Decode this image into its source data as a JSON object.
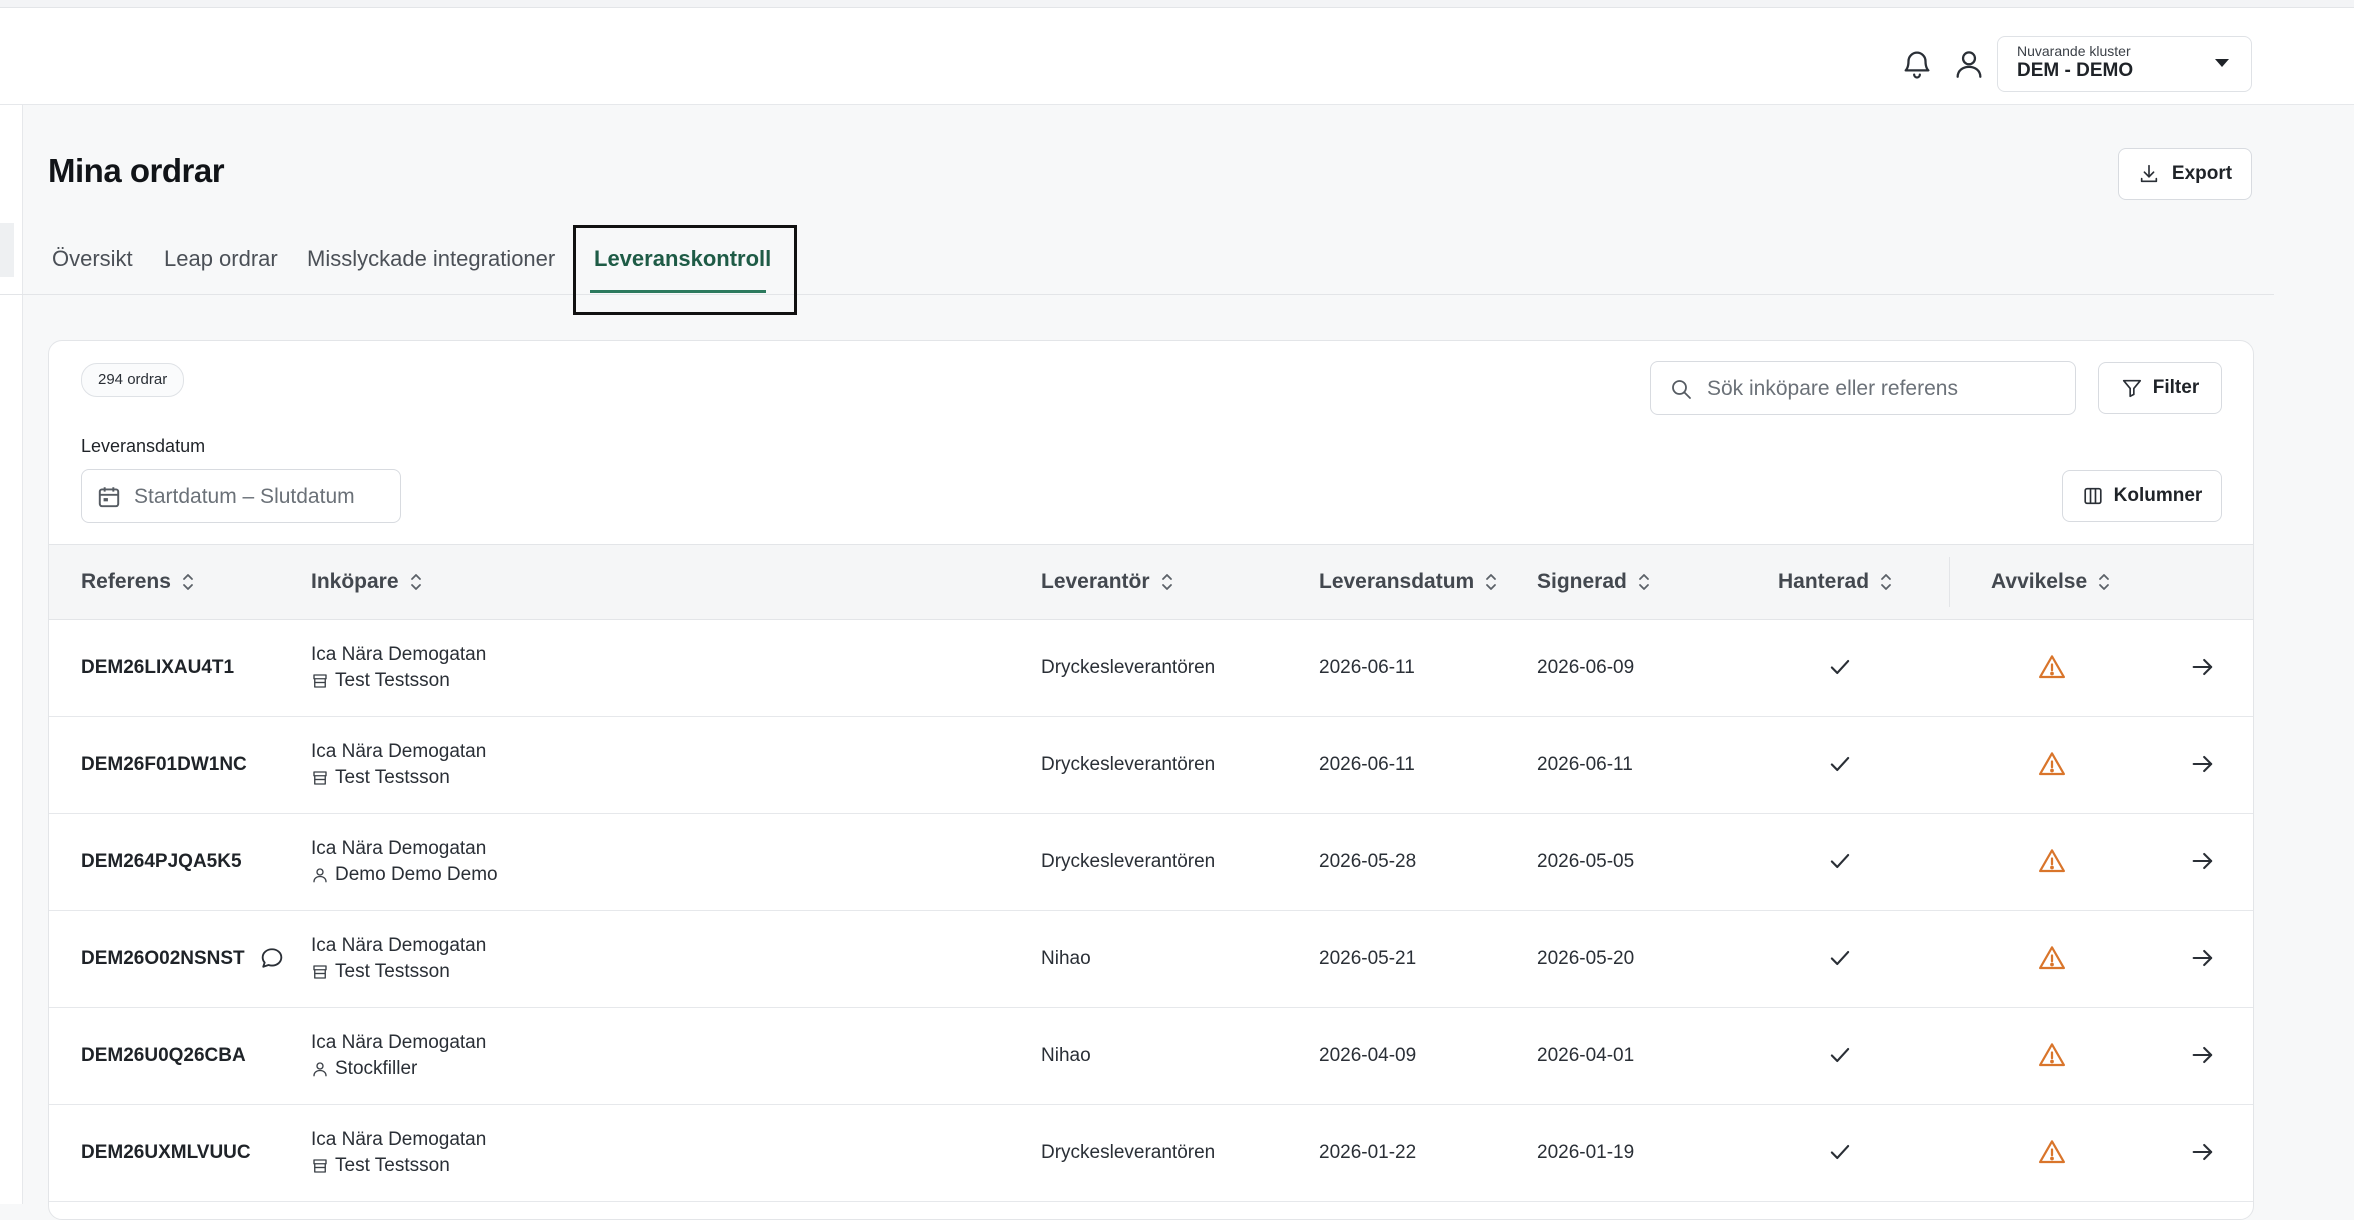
{
  "header": {
    "cluster_label": "Nuvarande kluster",
    "cluster_value": "DEM - DEMO"
  },
  "page": {
    "title": "Mina ordrar",
    "export_label": "Export"
  },
  "tabs": [
    {
      "label": "Översikt"
    },
    {
      "label": "Leap ordrar"
    },
    {
      "label": "Misslyckade integrationer"
    },
    {
      "label": "Leveranskontroll",
      "active": true
    }
  ],
  "toolbar": {
    "count": "294 ordrar",
    "search_placeholder": "Sök inköpare eller referens",
    "filter_label": "Filter",
    "date_label": "Leveransdatum",
    "date_placeholder": "Startdatum – Slutdatum",
    "columns_label": "Kolumner"
  },
  "columns": [
    "Referens",
    "Inköpare",
    "Leverantör",
    "Leveransdatum",
    "Signerad",
    "Hanterad",
    "Avvikelse"
  ],
  "rows": [
    {
      "ref": "DEM26LIXAU4T1",
      "buyer": "Ica Nära Demogatan",
      "person": "Test Testsson",
      "person_icon": "store-icon",
      "supplier": "Dryckesleverantören",
      "delivery": "2026-06-11",
      "signed": "2026-06-09",
      "comment": false
    },
    {
      "ref": "DEM26F01DW1NC",
      "buyer": "Ica Nära Demogatan",
      "person": "Test Testsson",
      "person_icon": "store-icon",
      "supplier": "Dryckesleverantören",
      "delivery": "2026-06-11",
      "signed": "2026-06-11",
      "comment": false
    },
    {
      "ref": "DEM264PJQA5K5",
      "buyer": "Ica Nära Demogatan",
      "person": "Demo Demo Demo",
      "person_icon": "user-icon",
      "supplier": "Dryckesleverantören",
      "delivery": "2026-05-28",
      "signed": "2026-05-05",
      "comment": false
    },
    {
      "ref": "DEM26O02NSNST",
      "buyer": "Ica Nära Demogatan",
      "person": "Test Testsson",
      "person_icon": "store-icon",
      "supplier": "Nihao",
      "delivery": "2026-05-21",
      "signed": "2026-05-20",
      "comment": true
    },
    {
      "ref": "DEM26U0Q26CBA",
      "buyer": "Ica Nära Demogatan",
      "person": "Stockfiller",
      "person_icon": "user-icon",
      "supplier": "Nihao",
      "delivery": "2026-04-09",
      "signed": "2026-04-01",
      "comment": false
    },
    {
      "ref": "DEM26UXMLVUUC",
      "buyer": "Ica Nära Demogatan",
      "person": "Test Testsson",
      "person_icon": "store-icon",
      "supplier": "Dryckesleverantören",
      "delivery": "2026-01-22",
      "signed": "2026-01-19",
      "comment": false
    }
  ],
  "colors": {
    "accent": "#1e5b46",
    "warning": "#d9752b"
  }
}
